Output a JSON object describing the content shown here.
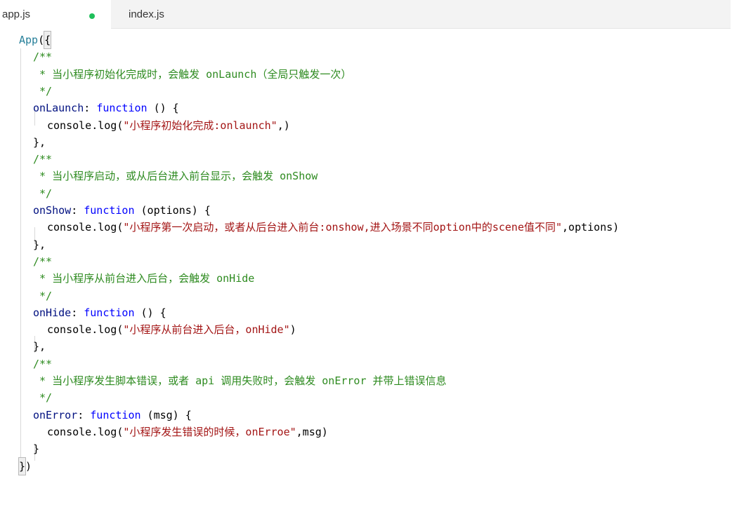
{
  "tabs": [
    {
      "label": "app.js",
      "modified_color": "#1fbf5a"
    },
    {
      "label": "index.js"
    }
  ],
  "code_lines": [
    {
      "indent": 0,
      "tokens": [
        {
          "t": "fn",
          "v": "App"
        },
        {
          "t": "pl",
          "v": "("
        },
        {
          "t": "br",
          "v": "{"
        }
      ]
    },
    {
      "indent": 1,
      "tokens": [
        {
          "t": "cm",
          "v": "/**"
        }
      ]
    },
    {
      "indent": 1,
      "tokens": [
        {
          "t": "cm",
          "v": " * 当小程序初始化完成时，会触发 onLaunch（全局只触发一次）"
        }
      ]
    },
    {
      "indent": 1,
      "tokens": [
        {
          "t": "cm",
          "v": " */"
        }
      ]
    },
    {
      "indent": 1,
      "tokens": [
        {
          "t": "id",
          "v": "onLaunch"
        },
        {
          "t": "pl",
          "v": ": "
        },
        {
          "t": "kw",
          "v": "function"
        },
        {
          "t": "pl",
          "v": " () {"
        }
      ]
    },
    {
      "indent": 2,
      "tokens": [
        {
          "t": "pl",
          "v": "console.log("
        },
        {
          "t": "st",
          "v": "\"小程序初始化完成:onlaunch\""
        },
        {
          "t": "pl",
          "v": ",)"
        }
      ]
    },
    {
      "indent": 1,
      "tokens": [
        {
          "t": "pl",
          "v": "},"
        }
      ]
    },
    {
      "indent": 1,
      "tokens": [
        {
          "t": "cm",
          "v": "/**"
        }
      ]
    },
    {
      "indent": 1,
      "tokens": [
        {
          "t": "cm",
          "v": " * 当小程序启动，或从后台进入前台显示，会触发 onShow"
        }
      ]
    },
    {
      "indent": 1,
      "tokens": [
        {
          "t": "cm",
          "v": " */"
        }
      ]
    },
    {
      "indent": 1,
      "tokens": [
        {
          "t": "id",
          "v": "onShow"
        },
        {
          "t": "pl",
          "v": ": "
        },
        {
          "t": "kw",
          "v": "function"
        },
        {
          "t": "pl",
          "v": " (options) {"
        }
      ]
    },
    {
      "indent": 2,
      "tokens": [
        {
          "t": "pl",
          "v": "console.log("
        },
        {
          "t": "st",
          "v": "\"小程序第一次启动，或者从后台进入前台:onshow,进入场景不同option中的scene值不同\""
        },
        {
          "t": "pl",
          "v": ",options)"
        }
      ]
    },
    {
      "indent": 1,
      "tokens": [
        {
          "t": "pl",
          "v": "},"
        }
      ]
    },
    {
      "indent": 1,
      "tokens": [
        {
          "t": "cm",
          "v": "/**"
        }
      ]
    },
    {
      "indent": 1,
      "tokens": [
        {
          "t": "cm",
          "v": " * 当小程序从前台进入后台，会触发 onHide"
        }
      ]
    },
    {
      "indent": 1,
      "tokens": [
        {
          "t": "cm",
          "v": " */"
        }
      ]
    },
    {
      "indent": 1,
      "tokens": [
        {
          "t": "id",
          "v": "onHide"
        },
        {
          "t": "pl",
          "v": ": "
        },
        {
          "t": "kw",
          "v": "function"
        },
        {
          "t": "pl",
          "v": " () {"
        }
      ]
    },
    {
      "indent": 2,
      "tokens": [
        {
          "t": "pl",
          "v": "console.log("
        },
        {
          "t": "st",
          "v": "\"小程序从前台进入后台，onHide\""
        },
        {
          "t": "pl",
          "v": ")"
        }
      ]
    },
    {
      "indent": 1,
      "tokens": [
        {
          "t": "pl",
          "v": "},"
        }
      ]
    },
    {
      "indent": 1,
      "tokens": [
        {
          "t": "cm",
          "v": "/**"
        }
      ]
    },
    {
      "indent": 1,
      "tokens": [
        {
          "t": "cm",
          "v": " * 当小程序发生脚本错误，或者 api 调用失败时，会触发 onError 并带上错误信息"
        }
      ]
    },
    {
      "indent": 1,
      "tokens": [
        {
          "t": "cm",
          "v": " */"
        }
      ]
    },
    {
      "indent": 1,
      "tokens": [
        {
          "t": "id",
          "v": "onError"
        },
        {
          "t": "pl",
          "v": ": "
        },
        {
          "t": "kw",
          "v": "function"
        },
        {
          "t": "pl",
          "v": " (msg) {"
        }
      ]
    },
    {
      "indent": 2,
      "tokens": [
        {
          "t": "pl",
          "v": "console.log("
        },
        {
          "t": "st",
          "v": "\"小程序发生错误的时候，onErroe\""
        },
        {
          "t": "pl",
          "v": ",msg)"
        }
      ]
    },
    {
      "indent": 1,
      "tokens": [
        {
          "t": "pl",
          "v": "}"
        }
      ]
    },
    {
      "indent": 0,
      "tokens": [
        {
          "t": "br",
          "v": "}"
        },
        {
          "t": "pl",
          "v": ")"
        }
      ]
    }
  ],
  "colors": {
    "function_name": "#267f99",
    "comment": "#2e8b20",
    "keyword": "#0000ff",
    "identifier": "#001080",
    "string": "#a31515",
    "plain": "#000000"
  }
}
